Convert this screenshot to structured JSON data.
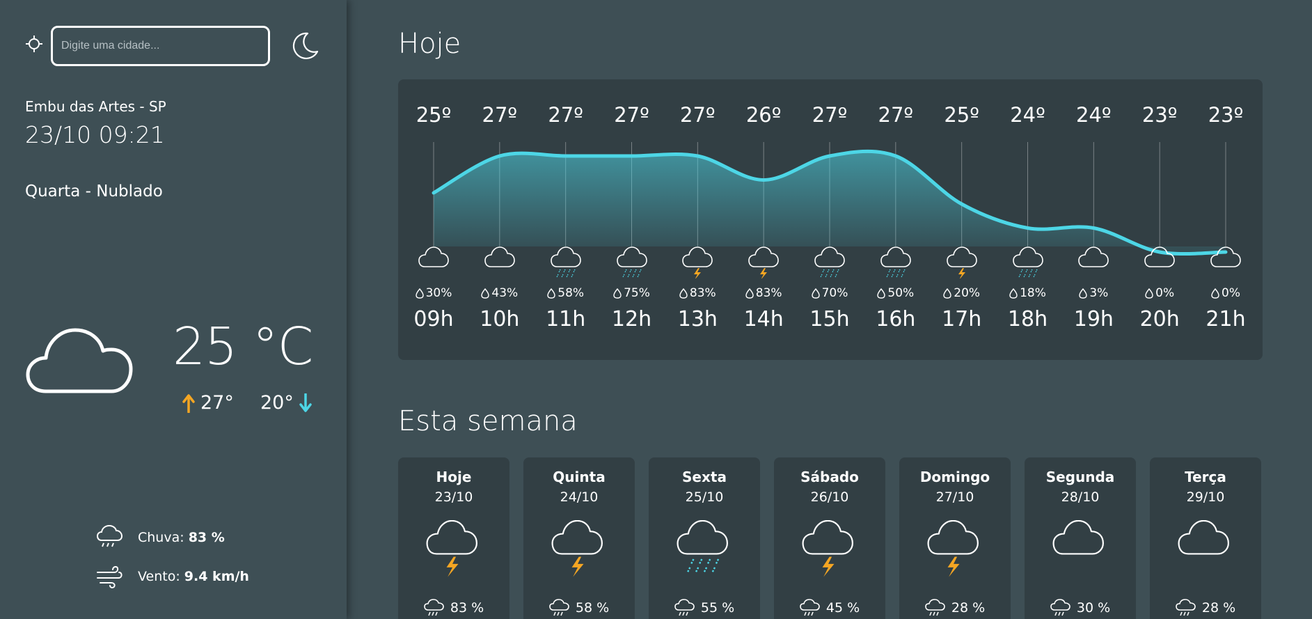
{
  "search": {
    "placeholder": "Digite uma cidade..."
  },
  "current": {
    "location": "Embu das Artes - SP",
    "datetime": "23/10 09:21",
    "condition": "Quarta - Nublado",
    "temp": "25 °C",
    "high": "27°",
    "low": "20°",
    "icon": "cloud-icon"
  },
  "stats": {
    "rain_label": "Chuva:",
    "rain_value": "83 %",
    "wind_label": "Vento:",
    "wind_value": "9.4 km/h"
  },
  "today": {
    "title": "Hoje",
    "hours": [
      {
        "hour": "09h",
        "temp": "25º",
        "rain": "30%",
        "icon": "cloud"
      },
      {
        "hour": "10h",
        "temp": "27º",
        "rain": "43%",
        "icon": "cloud"
      },
      {
        "hour": "11h",
        "temp": "27º",
        "rain": "58%",
        "icon": "rain"
      },
      {
        "hour": "12h",
        "temp": "27º",
        "rain": "75%",
        "icon": "rain"
      },
      {
        "hour": "13h",
        "temp": "27º",
        "rain": "83%",
        "icon": "storm"
      },
      {
        "hour": "14h",
        "temp": "26º",
        "rain": "83%",
        "icon": "storm"
      },
      {
        "hour": "15h",
        "temp": "27º",
        "rain": "70%",
        "icon": "rain"
      },
      {
        "hour": "16h",
        "temp": "27º",
        "rain": "50%",
        "icon": "rain"
      },
      {
        "hour": "17h",
        "temp": "25º",
        "rain": "20%",
        "icon": "storm"
      },
      {
        "hour": "18h",
        "temp": "24º",
        "rain": "18%",
        "icon": "rain"
      },
      {
        "hour": "19h",
        "temp": "24º",
        "rain": "3%",
        "icon": "cloud"
      },
      {
        "hour": "20h",
        "temp": "23º",
        "rain": "0%",
        "icon": "cloud"
      },
      {
        "hour": "21h",
        "temp": "23º",
        "rain": "0%",
        "icon": "cloud"
      }
    ]
  },
  "week": {
    "title": "Esta semana",
    "days": [
      {
        "name": "Hoje",
        "date": "23/10",
        "rain": "83 %",
        "icon": "storm"
      },
      {
        "name": "Quinta",
        "date": "24/10",
        "rain": "58 %",
        "icon": "storm"
      },
      {
        "name": "Sexta",
        "date": "25/10",
        "rain": "55 %",
        "icon": "rain"
      },
      {
        "name": "Sábado",
        "date": "26/10",
        "rain": "45 %",
        "icon": "storm"
      },
      {
        "name": "Domingo",
        "date": "27/10",
        "rain": "28 %",
        "icon": "storm"
      },
      {
        "name": "Segunda",
        "date": "28/10",
        "rain": "30 %",
        "icon": "cloud"
      },
      {
        "name": "Terça",
        "date": "29/10",
        "rain": "28 %",
        "icon": "cloud"
      }
    ]
  },
  "colors": {
    "accent": "#4dd6e6",
    "bolt": "#f5a623",
    "up_arrow": "#f5a623",
    "down_arrow": "#4dd6e6",
    "panel": "#323f44",
    "background": "#3e4f55"
  }
}
